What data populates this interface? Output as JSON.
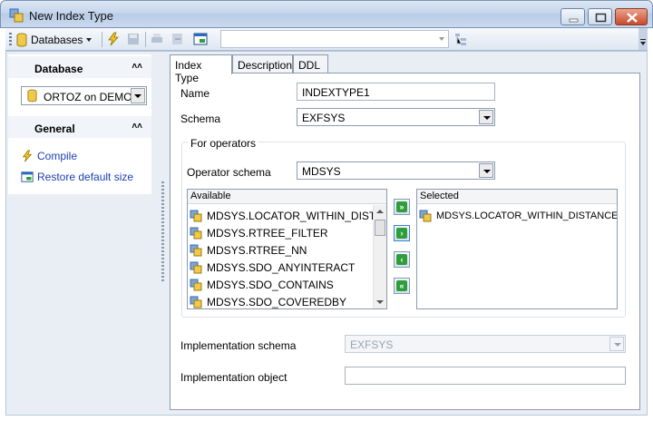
{
  "window": {
    "title": "New Index Type"
  },
  "toolbar": {
    "databases_label": "Databases",
    "combo_value": ""
  },
  "left_panel": {
    "database_header": "Database",
    "database_value": "ORTOZ on DEMO",
    "general_header": "General",
    "links": [
      {
        "label": "Compile",
        "icon": "lightning-icon"
      },
      {
        "label": "Restore default size",
        "icon": "window-restore-icon"
      }
    ]
  },
  "tabs": [
    {
      "label": "Index Type",
      "active": true
    },
    {
      "label": "Description",
      "active": false
    },
    {
      "label": "DDL",
      "active": false
    }
  ],
  "form": {
    "name_label": "Name",
    "name_value": "INDEXTYPE1",
    "schema_label": "Schema",
    "schema_value": "EXFSYS",
    "operators_group": "For operators",
    "operator_schema_label": "Operator schema",
    "operator_schema_value": "MDSYS",
    "available_header": "Available",
    "available_items": [
      "MDSYS.LOCATOR_WITHIN_DISTAI",
      "MDSYS.RTREE_FILTER",
      "MDSYS.RTREE_NN",
      "MDSYS.SDO_ANYINTERACT",
      "MDSYS.SDO_CONTAINS",
      "MDSYS.SDO_COVEREDBY"
    ],
    "selected_header": "Selected",
    "selected_items": [
      "MDSYS.LOCATOR_WITHIN_DISTANCE"
    ],
    "impl_schema_label": "Implementation schema",
    "impl_schema_value": "EXFSYS",
    "impl_object_label": "Implementation object",
    "impl_object_value": ""
  },
  "colors": {
    "link": "#1a3fb4",
    "accent_green": "#2f9e3a",
    "close_red": "#c94a2c"
  }
}
